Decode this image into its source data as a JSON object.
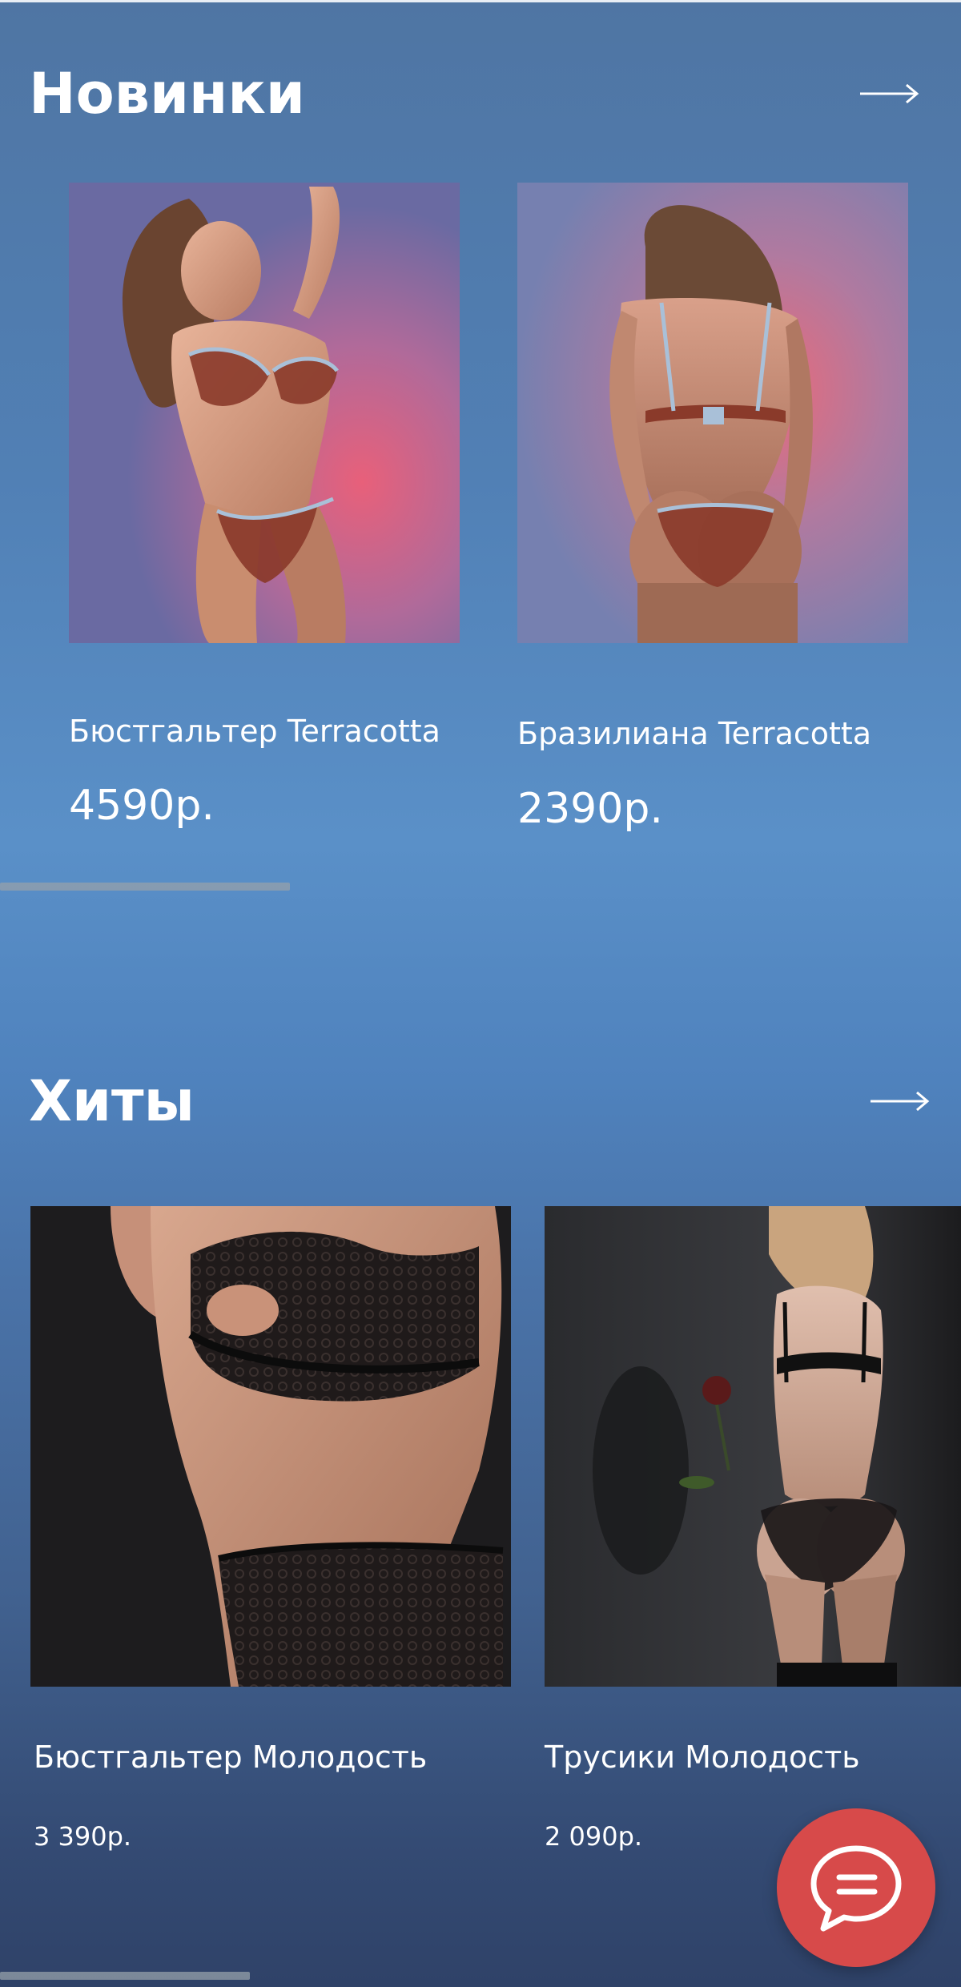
{
  "sections": {
    "new": {
      "title": "Новинки",
      "products": [
        {
          "name": "Бюстгальтер Terracotta",
          "price": "4590р."
        },
        {
          "name": "Бразилиана Terracotta",
          "price": "2390р."
        }
      ]
    },
    "hits": {
      "title": "Хиты",
      "products": [
        {
          "name": "Бюстгальтер Молодость",
          "price": "3 390р."
        },
        {
          "name": "Трусики Молодость",
          "price": "2 090р."
        }
      ]
    }
  },
  "icons": {
    "section_arrow": "arrow-right-icon",
    "chat": "chat-bubble-icon"
  },
  "colors": {
    "chat_button": "#d74a4a",
    "text": "#ffffff"
  }
}
